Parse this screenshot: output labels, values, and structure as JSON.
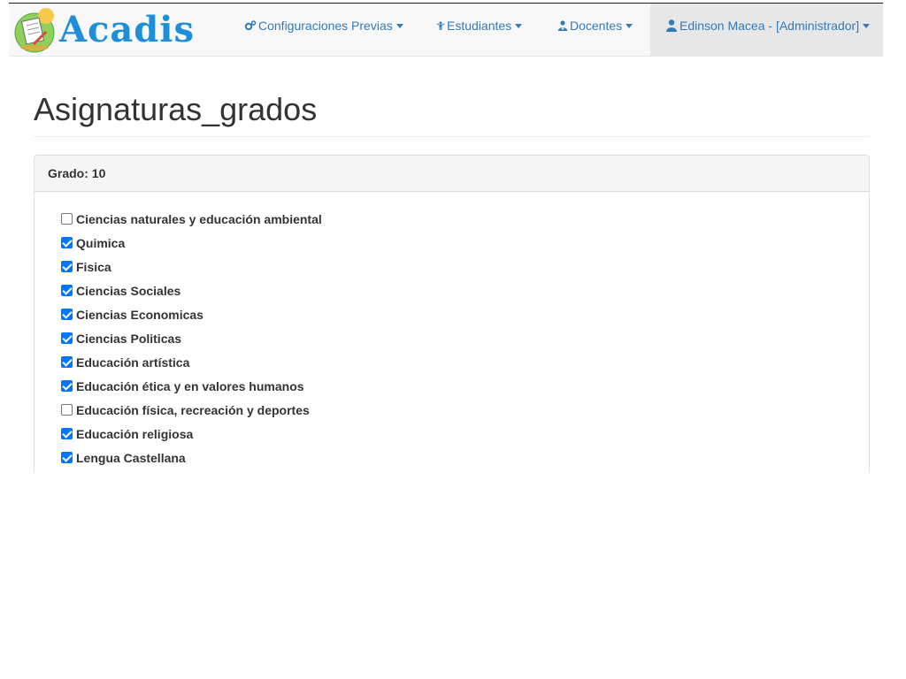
{
  "brand": {
    "name": "Acadis"
  },
  "nav": {
    "config": {
      "label": "Configuraciones Previas"
    },
    "students": {
      "label": "Estudiantes"
    },
    "teachers": {
      "label": "Docentes"
    },
    "user": {
      "label": "Edinson Macea - [Administrador]"
    }
  },
  "page": {
    "title": "Asignaturas_grados"
  },
  "panel": {
    "heading": "Grado: 10",
    "subjects": [
      {
        "label": "Ciencias naturales y educación ambiental",
        "checked": false
      },
      {
        "label": "Quimica",
        "checked": true
      },
      {
        "label": "Fisica",
        "checked": true
      },
      {
        "label": "Ciencias Sociales",
        "checked": true
      },
      {
        "label": "Ciencias Economicas",
        "checked": true
      },
      {
        "label": "Ciencias Politicas",
        "checked": true
      },
      {
        "label": "Educación artística",
        "checked": true
      },
      {
        "label": "Educación ética y en valores humanos",
        "checked": true
      },
      {
        "label": "Educación física, recreación y deportes",
        "checked": false
      },
      {
        "label": "Educación religiosa",
        "checked": true
      },
      {
        "label": "Lengua Castellana",
        "checked": true
      }
    ]
  },
  "colors": {
    "accent": "#337ab7",
    "checkbox": "#0075ff",
    "logo": "#1d8fd6"
  },
  "icons": {
    "config": "cogs-icon",
    "students": "child-icon",
    "teachers": "user-md-icon",
    "user": "user-icon"
  }
}
